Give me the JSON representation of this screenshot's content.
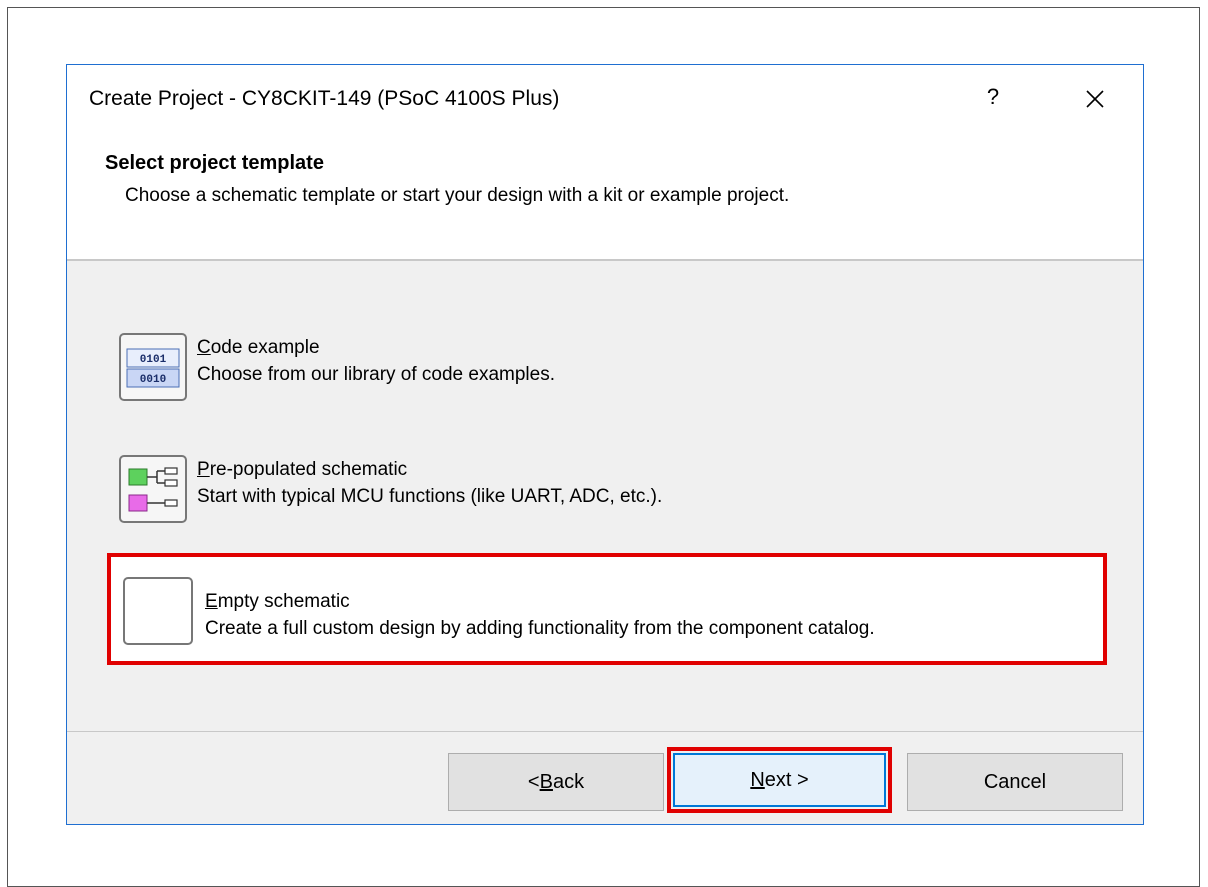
{
  "window": {
    "title": "Create Project - CY8CKIT-149 (PSoC 4100S Plus)",
    "help_label": "?"
  },
  "header": {
    "title": "Select project template",
    "subtitle": "Choose a schematic template or start your design with a kit or example project."
  },
  "options": [
    {
      "label_accel": "C",
      "label_rest": "ode example",
      "description": "Choose from our library of code examples.",
      "icon": "binary-code-icon",
      "selected": false
    },
    {
      "label_accel": "P",
      "label_rest": "re-populated schematic",
      "description": "Start with typical MCU functions (like UART, ADC, etc.).",
      "icon": "schematic-icon",
      "selected": false
    },
    {
      "label_accel": "E",
      "label_rest": "mpty schematic",
      "description": "Create a full custom design by adding functionality from the component catalog.",
      "icon": "empty-schematic-icon",
      "selected": true
    }
  ],
  "buttons": {
    "back_prefix": "< ",
    "back_accel": "B",
    "back_rest": "ack",
    "next_accel": "N",
    "next_rest": "ext >",
    "cancel": "Cancel"
  },
  "colors": {
    "highlight": "#e00000",
    "accent": "#0078d7",
    "dialog_bg": "#f0f0f0"
  }
}
